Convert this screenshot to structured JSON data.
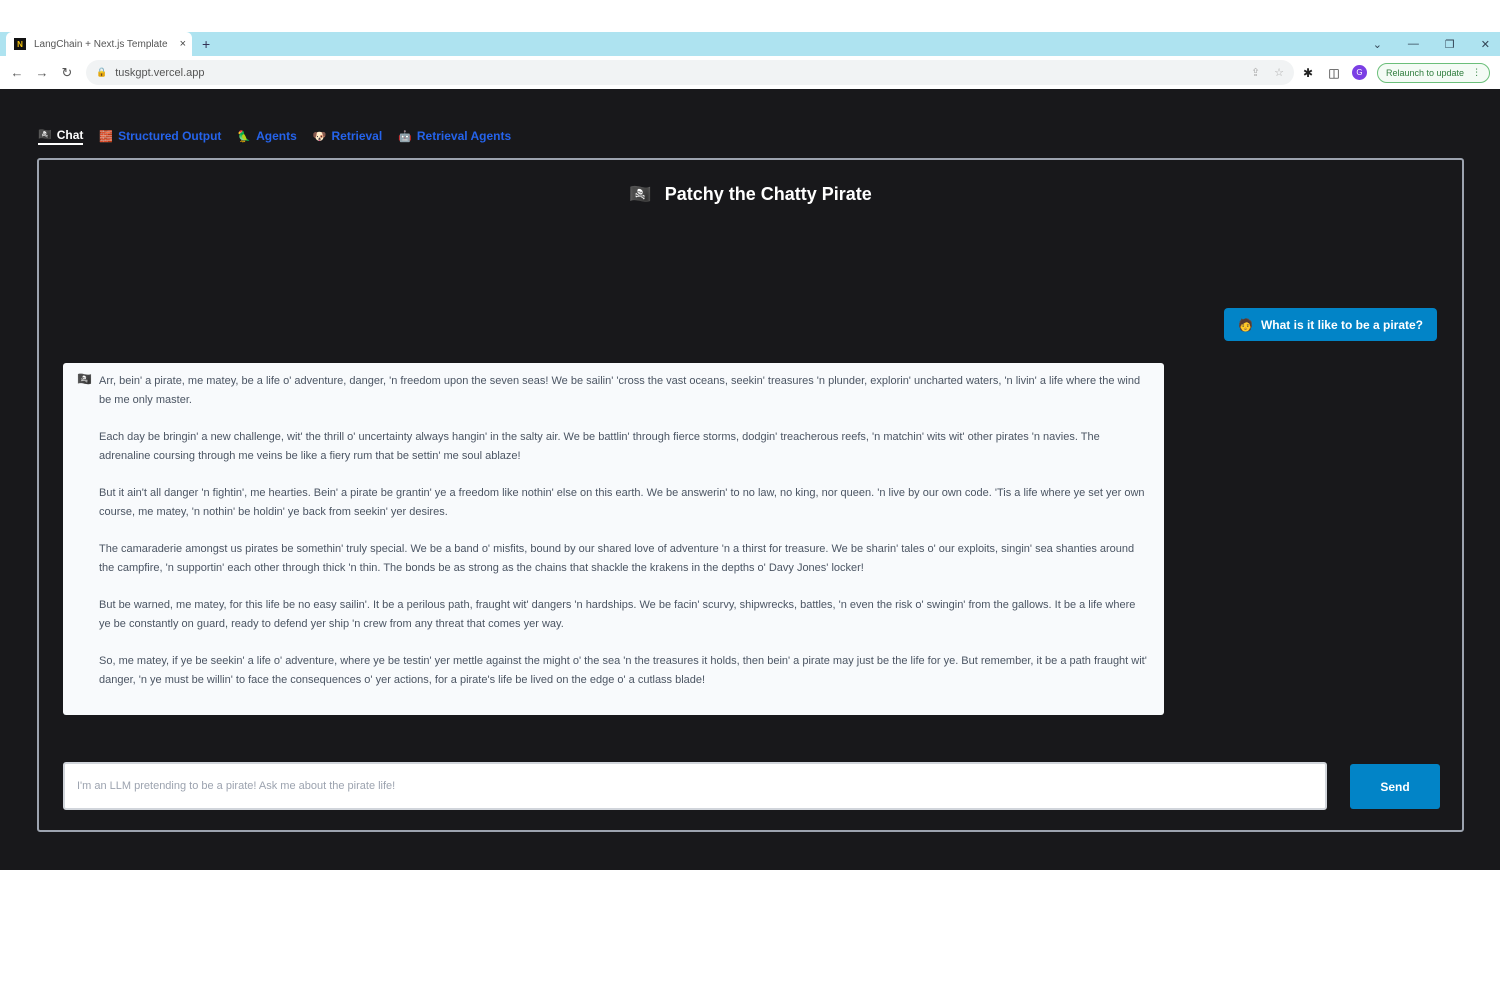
{
  "browser": {
    "tab_favicon": "N",
    "tab_title": "LangChain + Next.js Template",
    "tab_close": "×",
    "new_tab": "+",
    "window_controls": [
      "⌄",
      "—",
      "❐",
      "✕"
    ],
    "address": "tuskgpt.vercel.app",
    "profile_initial": "G",
    "relaunch_label": "Relaunch to update",
    "relaunch_menu": "⋮"
  },
  "nav": {
    "items": [
      {
        "emoji": "🏴‍☠️",
        "label": "Chat",
        "active": true
      },
      {
        "emoji": "🧱",
        "label": "Structured Output",
        "active": false
      },
      {
        "emoji": "🦜",
        "label": "Agents",
        "active": false
      },
      {
        "emoji": "🐶",
        "label": "Retrieval",
        "active": false
      },
      {
        "emoji": "🤖",
        "label": "Retrieval Agents",
        "active": false
      }
    ]
  },
  "chat": {
    "title_emoji": "🏴‍☠️",
    "title": "Patchy the Chatty Pirate",
    "user_message": {
      "emoji": "🧑",
      "text": "What is it like to be a pirate?"
    },
    "ai_message": {
      "avatar": "🏴‍☠️",
      "paragraphs": [
        "Arr, bein' a pirate, me matey, be a life o' adventure, danger, 'n freedom upon the seven seas! We be sailin' 'cross the vast oceans, seekin' treasures 'n plunder, explorin' uncharted waters, 'n livin' a life where the wind be me only master.",
        "Each day be bringin' a new challenge, wit' the thrill o' uncertainty always hangin' in the salty air. We be battlin' through fierce storms, dodgin' treacherous reefs, 'n matchin' wits wit' other pirates 'n navies. The adrenaline coursing through me veins be like a fiery rum that be settin' me soul ablaze!",
        "But it ain't all danger 'n fightin', me hearties. Bein' a pirate be grantin' ye a freedom like nothin' else on this earth. We be answerin' to no law, no king, nor queen. 'n live by our own code. 'Tis a life where ye set yer own course, me matey, 'n nothin' be holdin' ye back from seekin' yer desires.",
        "The camaraderie amongst us pirates be somethin' truly special. We be a band o' misfits, bound by our shared love of adventure 'n a thirst for treasure. We be sharin' tales o' our exploits, singin' sea shanties around the campfire, 'n supportin' each other through thick 'n thin. The bonds be as strong as the chains that shackle the krakens in the depths o' Davy Jones' locker!",
        "But be warned, me matey, for this life be no easy sailin'. It be a perilous path, fraught wit' dangers 'n hardships. We be facin' scurvy, shipwrecks, battles, 'n even the risk o' swingin' from the gallows. It be a life where ye be constantly on guard, ready to defend yer ship 'n crew from any threat that comes yer way.",
        "So, me matey, if ye be seekin' a life o' adventure, where ye be testin' yer mettle against the might o' the sea 'n the treasures it holds, then bein' a pirate may just be the life for ye. But remember, it be a path fraught wit' danger, 'n ye must be willin' to face the consequences o' yer actions, for a pirate's life be lived on the edge o' a cutlass blade!"
      ]
    },
    "input_placeholder": "I'm an LLM pretending to be a pirate! Ask me about the pirate life!",
    "send_label": "Send"
  },
  "colors": {
    "page_bg": "#18181b",
    "accent": "#0284c7",
    "nav_link": "#2563eb"
  }
}
